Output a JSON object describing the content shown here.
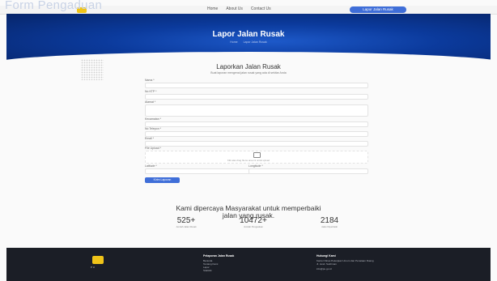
{
  "window": {
    "title": "Form Pengaduan"
  },
  "nav": {
    "items": [
      "Home",
      "About Us",
      "Contact Us"
    ],
    "cta_label": "Lapor Jalan Rusak"
  },
  "hero": {
    "title": "Lapor Jalan Rusak",
    "breadcrumb": [
      "Home",
      "Lapor Jalan Rusak"
    ]
  },
  "form": {
    "title": "Laporkan Jalan Rusak",
    "subtitle": "Buat laporan mengenai jalan rusak yang ada di sekitar Anda",
    "labels": {
      "nama": "Nama *",
      "nik": "No KTP *",
      "alamat": "Alamat *",
      "kecamatan": "Kecamatan *",
      "kelurahan": "No Telepon *",
      "email": "Email *",
      "file": "File Upload *",
      "latitude": "Latitude *",
      "longitude": "Longitude *"
    },
    "upload_hint": "Klik atau drag file ke area ini untuk upload",
    "submit_label": "Kirim Laporan"
  },
  "trust": {
    "title_line1": "Kami dipercaya Masyarakat untuk memperbaiki",
    "title_line2": "jalan yang rusak.",
    "stats": [
      {
        "value": "525+",
        "caption": "Jumlah Jalan Rusak"
      },
      {
        "value": "10472+",
        "caption": "Jumlah Pengaduan"
      },
      {
        "value": "2184",
        "caption": "Jalan Diperbaiki"
      }
    ]
  },
  "footer": {
    "logo_text": "P U",
    "col1_title": "Pelaporan Jalan Rusak",
    "col1_links": [
      "Beranda",
      "Tentang Kami",
      "Lapor",
      "Statistik"
    ],
    "col2_title": "Hubungi Kami",
    "col2_lines": [
      "Kantor Dinas Pekerjaan Umum dan Penataan Ruang",
      "Jl. Jend. Sudirman",
      "info@pu.go.id"
    ]
  },
  "colors": {
    "accent": "#3f6ed8",
    "hero_dark": "#07256a",
    "hero_mid": "#1d59c9",
    "footer_bg": "#1b1e26",
    "logo_yellow": "#f0c419"
  }
}
